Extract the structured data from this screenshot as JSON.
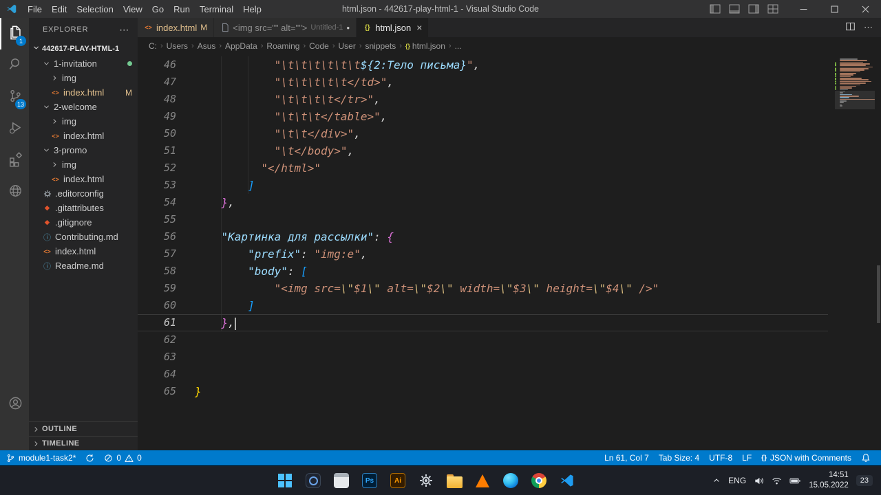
{
  "glyphs": {
    "more": "⋯",
    "close": "×",
    "dirty": "●",
    "separator": "›",
    "html": "<>",
    "json": "{}",
    "git": "◆",
    "info": "ⓘ"
  },
  "colors": {
    "accent": "#007acc",
    "statusbar": "#007acc",
    "editor_bg": "#1e1e1e",
    "sidebar_bg": "#252526",
    "activitybar_bg": "#333333",
    "taskbar_bg": "#1c1f26",
    "modified": "#e2c08d"
  },
  "titlebar": {
    "menus": [
      "File",
      "Edit",
      "Selection",
      "View",
      "Go",
      "Run",
      "Terminal",
      "Help"
    ],
    "title": "html.json - 442617-play-html-1 - Visual Studio Code"
  },
  "activity_bar": {
    "top": [
      {
        "id": "explorer",
        "icon": "files",
        "badge": "1",
        "active": true
      },
      {
        "id": "search",
        "icon": "search"
      },
      {
        "id": "source-control",
        "icon": "source-control",
        "badge": "13"
      },
      {
        "id": "run-and-debug",
        "icon": "debug"
      },
      {
        "id": "extensions",
        "icon": "extensions"
      },
      {
        "id": "browser-preview",
        "icon": "globe"
      }
    ],
    "bottom": [
      {
        "id": "account",
        "icon": "account"
      }
    ]
  },
  "sidebar": {
    "header": "EXPLORER",
    "root": "442617-PLAY-HTML-1",
    "tree": [
      {
        "label": "1-invitation",
        "type": "folder",
        "expanded": true,
        "depth": 1,
        "badge": "dot"
      },
      {
        "label": "img",
        "type": "folder",
        "expanded": false,
        "depth": 2
      },
      {
        "label": "index.html",
        "type": "html",
        "depth": 2,
        "badge": "M",
        "modified": true
      },
      {
        "label": "2-welcome",
        "type": "folder",
        "expanded": true,
        "depth": 1
      },
      {
        "label": "img",
        "type": "folder",
        "expanded": false,
        "depth": 2
      },
      {
        "label": "index.html",
        "type": "html",
        "depth": 2
      },
      {
        "label": "3-promo",
        "type": "folder",
        "expanded": true,
        "depth": 1
      },
      {
        "label": "img",
        "type": "folder",
        "expanded": false,
        "depth": 2
      },
      {
        "label": "index.html",
        "type": "html",
        "depth": 2
      },
      {
        "label": ".editorconfig",
        "type": "config",
        "depth": 1
      },
      {
        "label": ".gitattributes",
        "type": "git",
        "depth": 1
      },
      {
        "label": ".gitignore",
        "type": "git",
        "depth": 1
      },
      {
        "label": "Contributing.md",
        "type": "info",
        "depth": 1
      },
      {
        "label": "index.html",
        "type": "html",
        "depth": 1
      },
      {
        "label": "Readme.md",
        "type": "info",
        "depth": 1
      }
    ],
    "sections": [
      "OUTLINE",
      "TIMELINE"
    ]
  },
  "tabs": [
    {
      "id": "index-html",
      "icon": "html",
      "label": "index.html",
      "git": "M",
      "modified_color": true
    },
    {
      "id": "untitled-1",
      "icon": "file",
      "label": "<img src=\"\" alt=\"\">",
      "desc": "Untitled-1",
      "dirty": true
    },
    {
      "id": "html-json",
      "icon": "json",
      "label": "html.json",
      "active": true
    }
  ],
  "breadcrumbs": [
    {
      "label": "C:"
    },
    {
      "label": "Users"
    },
    {
      "label": "Asus"
    },
    {
      "label": "AppData"
    },
    {
      "label": "Roaming"
    },
    {
      "label": "Code"
    },
    {
      "label": "User"
    },
    {
      "label": "snippets"
    },
    {
      "label": "html.json",
      "icon": "json"
    },
    {
      "label": "..."
    }
  ],
  "editor": {
    "cursor": {
      "line": 61,
      "col": 7
    },
    "lines": [
      {
        "n": 46,
        "i": 12,
        "s": [
          [
            "str",
            "\"\\t\\t\\t\\t\\t\\t"
          ],
          [
            "ph",
            "${2:Тело письма}"
          ],
          [
            "str",
            "\""
          ],
          [
            "pun",
            ","
          ]
        ]
      },
      {
        "n": 47,
        "i": 12,
        "s": [
          [
            "str",
            "\"\\t\\t\\t\\t\\t</td>\""
          ],
          [
            "pun",
            ","
          ]
        ]
      },
      {
        "n": 48,
        "i": 12,
        "s": [
          [
            "str",
            "\"\\t\\t\\t\\t</tr>\""
          ],
          [
            "pun",
            ","
          ]
        ]
      },
      {
        "n": 49,
        "i": 12,
        "s": [
          [
            "str",
            "\"\\t\\t\\t</table>\""
          ],
          [
            "pun",
            ","
          ]
        ]
      },
      {
        "n": 50,
        "i": 12,
        "s": [
          [
            "str",
            "\"\\t\\t</div>\""
          ],
          [
            "pun",
            ","
          ]
        ]
      },
      {
        "n": 51,
        "i": 12,
        "s": [
          [
            "str",
            "\"\\t</body>\""
          ],
          [
            "pun",
            ","
          ]
        ]
      },
      {
        "n": 52,
        "i": 10,
        "s": [
          [
            "str",
            "\"</html>\""
          ]
        ]
      },
      {
        "n": 53,
        "i": 8,
        "s": [
          [
            "b3",
            "]"
          ]
        ]
      },
      {
        "n": 54,
        "i": 4,
        "s": [
          [
            "b2",
            "}"
          ],
          [
            "pun",
            ","
          ]
        ]
      },
      {
        "n": 55,
        "i": 0,
        "s": []
      },
      {
        "n": 56,
        "i": 4,
        "s": [
          [
            "key",
            "\"Картинка для рассылки\""
          ],
          [
            "pun",
            ": "
          ],
          [
            "b2",
            "{"
          ]
        ]
      },
      {
        "n": 57,
        "i": 8,
        "s": [
          [
            "key",
            "\"prefix\""
          ],
          [
            "pun",
            ": "
          ],
          [
            "str",
            "\"img:e\""
          ],
          [
            "pun",
            ","
          ]
        ]
      },
      {
        "n": 58,
        "i": 8,
        "s": [
          [
            "key",
            "\"body\""
          ],
          [
            "pun",
            ": "
          ],
          [
            "b3",
            "["
          ]
        ]
      },
      {
        "n": 59,
        "i": 12,
        "s": [
          [
            "str",
            "\"<img src="
          ],
          [
            "esc",
            "\\\""
          ],
          [
            "str",
            "$1"
          ],
          [
            "esc",
            "\\\""
          ],
          [
            "str",
            " alt="
          ],
          [
            "esc",
            "\\\""
          ],
          [
            "str",
            "$2"
          ],
          [
            "esc",
            "\\\""
          ],
          [
            "str",
            " width="
          ],
          [
            "esc",
            "\\\""
          ],
          [
            "str",
            "$3"
          ],
          [
            "esc",
            "\\\""
          ],
          [
            "str",
            " height="
          ],
          [
            "esc",
            "\\\""
          ],
          [
            "str",
            "$4"
          ],
          [
            "esc",
            "\\\""
          ],
          [
            "str",
            " />\""
          ]
        ]
      },
      {
        "n": 60,
        "i": 8,
        "s": [
          [
            "b3",
            "]"
          ]
        ]
      },
      {
        "n": 61,
        "i": 4,
        "s": [
          [
            "b2",
            "}"
          ],
          [
            "pun",
            ","
          ]
        ],
        "cursor": true,
        "current": true
      },
      {
        "n": 62,
        "i": 0,
        "s": []
      },
      {
        "n": 63,
        "i": 0,
        "s": []
      },
      {
        "n": 64,
        "i": 0,
        "s": []
      },
      {
        "n": 65,
        "i": 0,
        "s": [
          [
            "b1",
            "}"
          ]
        ]
      }
    ],
    "minimap": [
      [
        26,
        "w",
        0
      ],
      [
        40,
        "o",
        0
      ],
      [
        34,
        "o",
        1
      ],
      [
        44,
        "o",
        1
      ],
      [
        38,
        "o",
        1
      ],
      [
        48,
        "o",
        1
      ],
      [
        42,
        "o",
        1
      ],
      [
        36,
        "o",
        1
      ],
      [
        30,
        "o",
        1
      ],
      [
        24,
        "o",
        1
      ],
      [
        20,
        "o",
        1
      ],
      [
        16,
        "o",
        1
      ],
      [
        32,
        "o",
        1
      ],
      [
        42,
        "o",
        1
      ],
      [
        46,
        "o",
        1
      ],
      [
        38,
        "o",
        1
      ],
      [
        30,
        "o",
        1
      ],
      [
        24,
        "o",
        1
      ],
      [
        18,
        "o",
        1
      ],
      [
        12,
        "w",
        1
      ],
      [
        8,
        "w",
        0
      ],
      [
        5,
        "w",
        0
      ],
      [
        18,
        "k",
        0
      ],
      [
        28,
        "o",
        0
      ],
      [
        14,
        "k",
        0
      ],
      [
        52,
        "o",
        0
      ],
      [
        10,
        "w",
        0
      ],
      [
        6,
        "w",
        0
      ],
      [
        3,
        "w",
        0
      ],
      [
        4,
        "w",
        0
      ]
    ]
  },
  "statusbar": {
    "left": [
      {
        "id": "branch",
        "icon": "branch",
        "label": "module1-task2*"
      },
      {
        "id": "sync",
        "icon": "sync"
      },
      {
        "id": "problems",
        "errors": "0",
        "warnings": "0"
      }
    ],
    "right": [
      {
        "id": "cursor-position",
        "label": "Ln 61, Col 7"
      },
      {
        "id": "indentation",
        "label": "Tab Size: 4"
      },
      {
        "id": "encoding",
        "label": "UTF-8"
      },
      {
        "id": "eol",
        "label": "LF"
      },
      {
        "id": "language-mode",
        "prefix": "{}",
        "label": "JSON with Comments"
      },
      {
        "id": "notifications",
        "icon": "bell"
      }
    ]
  },
  "taskbar": {
    "apps": [
      {
        "id": "start"
      },
      {
        "id": "pinned-app-1"
      },
      {
        "id": "pinned-app-2"
      },
      {
        "id": "photoshop",
        "label": "Ps"
      },
      {
        "id": "illustrator",
        "label": "Ai"
      },
      {
        "id": "settings"
      },
      {
        "id": "file-explorer"
      },
      {
        "id": "vlc"
      },
      {
        "id": "edge"
      },
      {
        "id": "chrome"
      },
      {
        "id": "vscode"
      }
    ],
    "tray": {
      "language": "ENG",
      "time": "14:51",
      "date": "15.05.2022",
      "badge": "23"
    }
  }
}
